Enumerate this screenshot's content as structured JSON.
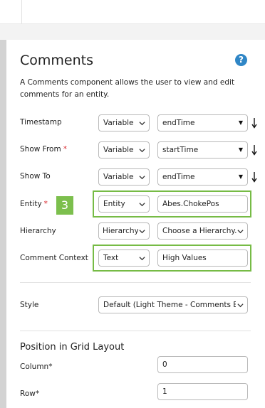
{
  "panel": {
    "title": "Comments",
    "help_glyph": "?",
    "description": "A Comments component allows the user to view and edit comments for an entity."
  },
  "rows": {
    "timestamp": {
      "label": "Timestamp",
      "type": "Variable",
      "value": "endTime"
    },
    "show_from": {
      "label": "Show From",
      "required": "*",
      "type": "Variable",
      "value": "startTime"
    },
    "show_to": {
      "label": "Show To",
      "type": "Variable",
      "value": "endTime"
    },
    "entity": {
      "label": "Entity",
      "required": "*",
      "type": "Entity",
      "value": "Abes.ChokePos"
    },
    "hierarchy": {
      "label": "Hierarchy",
      "type": "Hierarchy",
      "value": "Choose a Hierarchy..."
    },
    "comment_context": {
      "label": "Comment Context",
      "type": "Text",
      "value": "High Values"
    }
  },
  "step_badge": "3",
  "style": {
    "label": "Style",
    "value": "Default (Light Theme - Comments Blo"
  },
  "grid_layout": {
    "heading": "Position in Grid Layout",
    "column_label": "Column*",
    "column_value": "0",
    "row_label": "Row*",
    "row_value": "1"
  },
  "colors": {
    "highlight": "#76bb45",
    "help": "#2f86c6",
    "required": "#d9262c"
  }
}
